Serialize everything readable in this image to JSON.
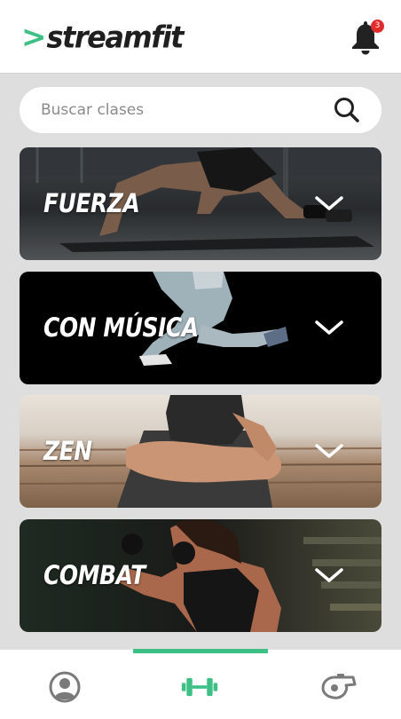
{
  "header": {
    "logo_arrow": ">",
    "logo_text": "streamfit",
    "brand_color": "#3dbf86",
    "notifications_icon": "bell-icon",
    "notification_count": "3"
  },
  "search": {
    "placeholder": "Buscar clases",
    "icon": "search-icon"
  },
  "categories": [
    {
      "label": "FUERZA",
      "icon": "chevron-down-icon"
    },
    {
      "label": "CON MÚSICA",
      "icon": "chevron-down-icon"
    },
    {
      "label": "ZEN",
      "icon": "chevron-down-icon"
    },
    {
      "label": "COMBAT",
      "icon": "chevron-down-icon"
    }
  ],
  "tabbar": {
    "tabs": [
      {
        "icon": "profile-icon",
        "active": false
      },
      {
        "icon": "dumbbell-icon",
        "active": true
      },
      {
        "icon": "whistle-icon",
        "active": false
      }
    ],
    "active_color": "#3dbf86",
    "inactive_color": "#7a7a7a"
  }
}
